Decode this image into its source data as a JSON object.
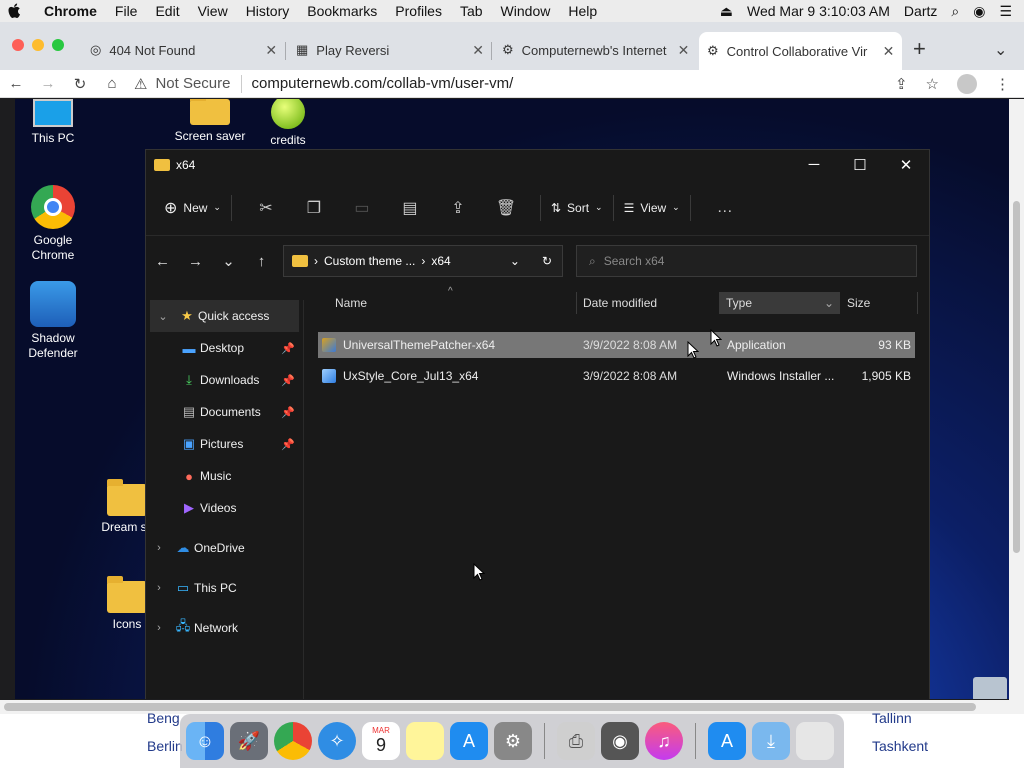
{
  "menubar": {
    "app": "Chrome",
    "items": [
      "File",
      "Edit",
      "View",
      "History",
      "Bookmarks",
      "Profiles",
      "Tab",
      "Window",
      "Help"
    ],
    "clock": "Wed Mar 9  3:10:03 AM",
    "user": "Dartz"
  },
  "tabs": [
    {
      "label": "404 Not Found",
      "icon": "globe-icon"
    },
    {
      "label": "Play Reversi",
      "icon": "reversi-icon"
    },
    {
      "label": "Computernewb's Internet",
      "icon": "computernewb-icon"
    },
    {
      "label": "Control Collaborative Vir",
      "icon": "computernewb-icon"
    }
  ],
  "toolbar": {
    "security": "Not Secure",
    "url": "computernewb.com/collab-vm/user-vm/"
  },
  "desktop": {
    "icons": [
      {
        "label": "This PC"
      },
      {
        "label": "Screen saver"
      },
      {
        "label": "credits"
      },
      {
        "label": "Google Chrome"
      },
      {
        "label": "Shadow Defender"
      },
      {
        "label": "Dream sc"
      },
      {
        "label": "Icons"
      }
    ]
  },
  "explorer": {
    "title": "x64",
    "commands": {
      "new": "New",
      "sort": "Sort",
      "view": "View",
      "more": "…"
    },
    "breadcrumb": [
      "Custom theme ...",
      "x64"
    ],
    "search_placeholder": "Search x64",
    "nav": {
      "quick_access": "Quick access",
      "items": [
        "Desktop",
        "Downloads",
        "Documents",
        "Pictures",
        "Music",
        "Videos"
      ],
      "onedrive": "OneDrive",
      "thispc": "This PC",
      "network": "Network"
    },
    "columns": {
      "name": "Name",
      "date": "Date modified",
      "type": "Type",
      "size": "Size"
    },
    "files": [
      {
        "name": "UniversalThemePatcher-x64",
        "date": "3/9/2022 8:08 AM",
        "type": "Application",
        "size": "93 KB"
      },
      {
        "name": "UxStyle_Core_Jul13_x64",
        "date": "3/9/2022 8:08 AM",
        "type": "Windows Installer ...",
        "size": "1,905 KB"
      }
    ]
  },
  "under": {
    "left": [
      "Beng",
      "Berlin"
    ],
    "right": [
      "Tallinn",
      "Tashkent"
    ]
  },
  "dock": {
    "calendar_month": "MAR",
    "calendar_day": "9"
  }
}
